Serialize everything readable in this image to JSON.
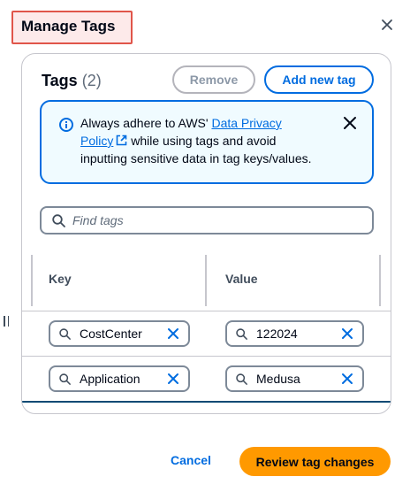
{
  "modal": {
    "title": "Manage Tags",
    "close_icon": "close-icon"
  },
  "tags_panel": {
    "heading": "Tags",
    "count": "(2)",
    "remove_label": "Remove",
    "add_label": "Add new tag",
    "alert": {
      "icon": "info-icon",
      "text_before": "Always adhere to AWS' ",
      "link_text": "Data Privacy Policy",
      "text_after": " while using tags and avoid inputting sensitive data in tag keys/values."
    },
    "search": {
      "placeholder": "Find tags",
      "value": ""
    },
    "columns": [
      "Key",
      "Value"
    ],
    "rows": [
      {
        "key": "CostCenter",
        "value": "122024"
      },
      {
        "key": "Application",
        "value": "Medusa"
      }
    ]
  },
  "footer": {
    "cancel_label": "Cancel",
    "review_label": "Review tag changes"
  },
  "colors": {
    "accent_blue": "#006ce0",
    "primary_orange": "#ff9900",
    "title_highlight": "#e0554a"
  }
}
